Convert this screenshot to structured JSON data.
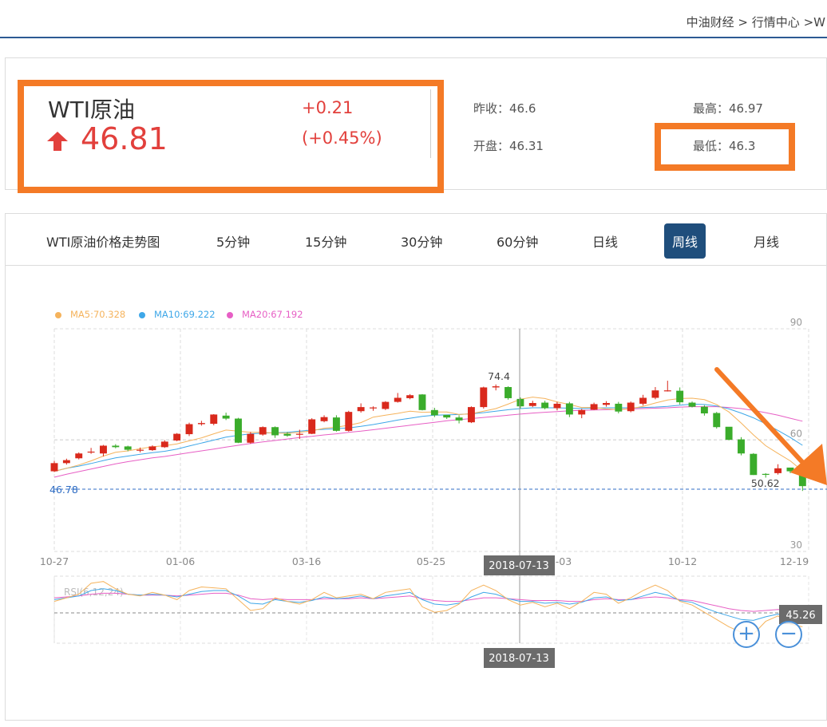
{
  "breadcrumb": {
    "site": "中油财经",
    "sep": ">",
    "section": "行情中心",
    "current": "W"
  },
  "quote": {
    "name": "WTI原油",
    "price": "46.81",
    "change": "+0.21",
    "change_pct": "(+0.45%)",
    "prev_close_label": "昨收：",
    "prev_close": "46.6",
    "open_label": "开盘：",
    "open": "46.31",
    "high_label": "最高：",
    "high": "46.97",
    "low_label": "最低：",
    "low": "46.3"
  },
  "tabs": {
    "title": "WTI原油价格走势图",
    "items": [
      "5分钟",
      "15分钟",
      "30分钟",
      "60分钟",
      "日线",
      "周线",
      "月线"
    ],
    "active": "周线"
  },
  "colors": {
    "up": "#d9291c",
    "down": "#3aac2b",
    "ma5": "#f5b35c",
    "ma10": "#3ea7e8",
    "ma20": "#e75fc5",
    "accent": "#1f4e7c",
    "highlight": "#f47a26"
  },
  "chart_data": {
    "type": "candlestick",
    "legend": [
      {
        "name": "MA5",
        "value": "70.328",
        "label": "MA5:70.328"
      },
      {
        "name": "MA10",
        "value": "69.222",
        "label": "MA10:69.222"
      },
      {
        "name": "MA20",
        "value": "67.192",
        "label": "MA20:67.192"
      }
    ],
    "y_ticks": [
      90,
      60,
      30
    ],
    "ylim": [
      30,
      90
    ],
    "x_ticks": [
      "10-27",
      "01-06",
      "03-16",
      "05-25",
      "08-03",
      "10-12",
      "12-19"
    ],
    "x_ticks_shown": [
      "10-27",
      "01-06",
      "03-16",
      "05-25",
      "",
      "10-12",
      "12-19"
    ],
    "crosshair_label": "2018-07-13",
    "current_price_line": 46.78,
    "current_price_label": "46.78",
    "max_label": "74.4",
    "min_label": "50.62",
    "candles_ohlc": [
      [
        51.6,
        53.8,
        51.4,
        54.4
      ],
      [
        53.8,
        54.6,
        53.4,
        55.0
      ],
      [
        55.1,
        56.4,
        54.8,
        56.7
      ],
      [
        56.8,
        56.9,
        56.3,
        57.9
      ],
      [
        56.4,
        58.5,
        55.6,
        58.7
      ],
      [
        58.5,
        58.1,
        57.8,
        58.9
      ],
      [
        58.3,
        57.4,
        57.0,
        58.5
      ],
      [
        57.4,
        57.4,
        56.7,
        58.0
      ],
      [
        57.3,
        58.3,
        57.1,
        58.6
      ],
      [
        58.1,
        59.6,
        57.9,
        60.0
      ],
      [
        59.9,
        61.7,
        59.7,
        61.9
      ],
      [
        61.6,
        64.3,
        61.1,
        64.7
      ],
      [
        64.3,
        64.6,
        63.9,
        65.2
      ],
      [
        64.4,
        66.9,
        64.0,
        67.0
      ],
      [
        66.6,
        65.8,
        65.4,
        67.4
      ],
      [
        65.8,
        59.3,
        59.2,
        66.0
      ],
      [
        59.3,
        61.7,
        59.0,
        62.2
      ],
      [
        61.5,
        63.5,
        61.2,
        63.7
      ],
      [
        63.5,
        61.3,
        60.6,
        63.7
      ],
      [
        61.7,
        61.2,
        60.9,
        62.2
      ],
      [
        61.5,
        61.7,
        60.3,
        62.8
      ],
      [
        61.7,
        65.6,
        61.6,
        65.9
      ],
      [
        65.1,
        66.2,
        64.8,
        66.7
      ],
      [
        66.1,
        62.5,
        62.3,
        66.7
      ],
      [
        62.5,
        67.6,
        62.3,
        67.9
      ],
      [
        67.8,
        68.9,
        67.4,
        69.9
      ],
      [
        68.8,
        68.8,
        67.9,
        69.1
      ],
      [
        68.4,
        70.3,
        68.1,
        70.5
      ],
      [
        70.3,
        71.4,
        70.1,
        72.7
      ],
      [
        71.3,
        72.1,
        71.0,
        72.4
      ],
      [
        72.3,
        68.1,
        68.0,
        72.4
      ],
      [
        68.1,
        66.7,
        66.2,
        68.7
      ],
      [
        66.8,
        66.1,
        65.7,
        66.5
      ],
      [
        66.1,
        65.3,
        64.5,
        66.7
      ],
      [
        64.8,
        68.9,
        64.6,
        69.1
      ],
      [
        68.9,
        74.2,
        68.5,
        74.4
      ],
      [
        74.2,
        74.5,
        73.4,
        75.0
      ],
      [
        74.3,
        71.3,
        70.9,
        74.5
      ],
      [
        71.1,
        69.1,
        68.5,
        71.5
      ],
      [
        69.2,
        70.0,
        68.9,
        70.6
      ],
      [
        70.1,
        68.6,
        68.3,
        70.6
      ],
      [
        68.6,
        69.8,
        68.0,
        70.3
      ],
      [
        69.9,
        66.9,
        66.2,
        70.3
      ],
      [
        66.9,
        68.1,
        65.9,
        68.4
      ],
      [
        68.2,
        69.7,
        68.1,
        70.1
      ],
      [
        69.5,
        70.0,
        69.0,
        70.5
      ],
      [
        69.8,
        67.7,
        67.2,
        70.3
      ],
      [
        67.8,
        70.1,
        67.5,
        70.4
      ],
      [
        69.8,
        71.4,
        69.3,
        72.2
      ],
      [
        71.4,
        73.4,
        71.0,
        74.3
      ],
      [
        73.3,
        73.4,
        73.1,
        76.0
      ],
      [
        73.3,
        70.2,
        69.6,
        74.2
      ],
      [
        70.1,
        69.0,
        68.8,
        70.4
      ],
      [
        69.0,
        67.2,
        66.6,
        69.4
      ],
      [
        67.3,
        63.5,
        63.1,
        67.6
      ],
      [
        63.6,
        60.1,
        59.9,
        63.5
      ],
      [
        60.2,
        56.4,
        55.9,
        60.8
      ],
      [
        56.3,
        50.6,
        50.6,
        56.5
      ],
      [
        50.9,
        50.8,
        49.9,
        51.1
      ],
      [
        51.1,
        52.4,
        50.7,
        53.5
      ],
      [
        52.6,
        51.6,
        51.1,
        52.4
      ],
      [
        51.5,
        47.6,
        46.3,
        51.7
      ]
    ],
    "ma5": [
      51.6,
      52.4,
      53.3,
      54.4,
      55.7,
      56.7,
      57.1,
      57.7,
      58.2,
      58.5,
      59.0,
      59.8,
      60.6,
      61.7,
      62.7,
      62.4,
      62.1,
      62.1,
      61.9,
      61.9,
      62.1,
      62.5,
      63.2,
      63.5,
      64.0,
      64.7,
      66.2,
      66.7,
      67.2,
      67.8,
      67.5,
      67.6,
      67.6,
      66.9,
      67.1,
      67.8,
      68.5,
      69.7,
      71.0,
      71.6,
      71.2,
      70.3,
      69.6,
      68.8,
      68.8,
      68.4,
      68.2,
      68.5,
      69.1,
      70.0,
      70.8,
      71.2,
      71.3,
      70.9,
      69.6,
      67.6,
      64.6,
      61.4,
      58.5,
      56.4,
      54.4,
      51.7
    ],
    "ma10": [
      51.6,
      52.4,
      53.0,
      53.7,
      54.5,
      55.2,
      55.7,
      56.2,
      56.6,
      57.0,
      57.6,
      58.4,
      59.2,
      60.0,
      60.8,
      61.3,
      61.7,
      61.9,
      62.0,
      62.1,
      62.4,
      62.7,
      62.9,
      63.1,
      63.3,
      63.7,
      64.2,
      64.8,
      65.4,
      65.9,
      66.4,
      66.7,
      66.8,
      66.9,
      67.1,
      67.4,
      67.8,
      68.2,
      68.5,
      68.7,
      68.7,
      68.7,
      68.6,
      68.5,
      68.6,
      68.7,
      68.7,
      68.7,
      68.8,
      68.9,
      69.1,
      69.4,
      69.7,
      69.6,
      69.2,
      68.4,
      67.3,
      66.0,
      64.4,
      62.6,
      60.7,
      58.6
    ],
    "ma20": [
      50.0,
      50.8,
      51.5,
      52.2,
      52.9,
      53.6,
      54.2,
      54.7,
      55.2,
      55.6,
      56.1,
      56.6,
      57.1,
      57.6,
      58.1,
      58.6,
      59.1,
      59.5,
      59.9,
      60.3,
      60.7,
      61.0,
      61.4,
      61.7,
      62.1,
      62.4,
      62.8,
      63.2,
      63.6,
      64.0,
      64.4,
      64.8,
      65.2,
      65.5,
      65.8,
      66.1,
      66.4,
      66.7,
      67.0,
      67.3,
      67.5,
      67.7,
      67.9,
      68.0,
      68.1,
      68.2,
      68.3,
      68.4,
      68.5,
      68.6,
      68.7,
      68.9,
      69.0,
      69.0,
      69.0,
      68.8,
      68.5,
      68.0,
      67.4,
      66.7,
      65.9,
      65.1
    ],
    "rsi_title": "RSI(6,12,24)",
    "rsi_value_label": "45.26",
    "rsi6": [
      58,
      62,
      66,
      78,
      80,
      72,
      66,
      64,
      68,
      65,
      60,
      70,
      74,
      73,
      72,
      60,
      48,
      50,
      62,
      58,
      55,
      60,
      68,
      62,
      64,
      66,
      61,
      68,
      70,
      72,
      52,
      46,
      48,
      55,
      70,
      76,
      70,
      60,
      54,
      57,
      52,
      56,
      50,
      58,
      68,
      66,
      56,
      62,
      70,
      76,
      70,
      58,
      54,
      46,
      38,
      30,
      24,
      22,
      36,
      42,
      33,
      30
    ],
    "rsi12": [
      60,
      62,
      64,
      70,
      72,
      70,
      66,
      65,
      66,
      65,
      63,
      66,
      69,
      70,
      70,
      64,
      56,
      55,
      60,
      58,
      57,
      59,
      63,
      61,
      62,
      64,
      61,
      64,
      66,
      68,
      60,
      55,
      54,
      56,
      63,
      68,
      66,
      61,
      58,
      58,
      56,
      57,
      55,
      57,
      62,
      63,
      59,
      60,
      64,
      68,
      65,
      59,
      57,
      51,
      46,
      42,
      38,
      37,
      41,
      44,
      40,
      38
    ],
    "rsi24": [
      62,
      63,
      64,
      66,
      67,
      67,
      66,
      65,
      65,
      65,
      64,
      65,
      66,
      67,
      67,
      65,
      61,
      60,
      61,
      60,
      60,
      60,
      61,
      61,
      61,
      62,
      61,
      62,
      63,
      64,
      61,
      59,
      58,
      58,
      60,
      62,
      62,
      61,
      60,
      59,
      59,
      59,
      58,
      58,
      60,
      61,
      60,
      60,
      62,
      63,
      62,
      60,
      59,
      56,
      53,
      50,
      48,
      47,
      48,
      49,
      48,
      47
    ]
  },
  "annotation": {
    "arrow": "orange-arrow-icon"
  }
}
